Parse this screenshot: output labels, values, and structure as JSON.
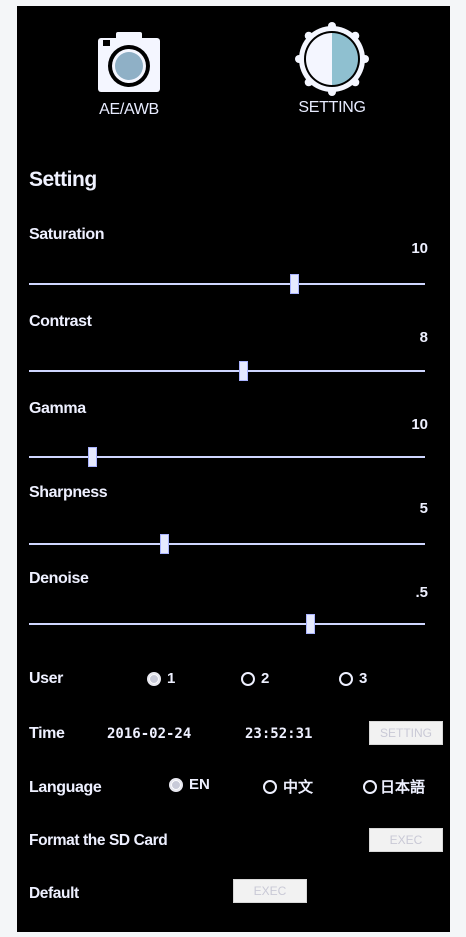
{
  "tabs": [
    {
      "label": "AE/AWB",
      "icon": "camera-icon"
    },
    {
      "label": "SETTING",
      "icon": "setting-icon"
    }
  ],
  "title": "Setting",
  "sliders": [
    {
      "label": "Saturation",
      "value": "10",
      "level": 0.67
    },
    {
      "label": "Contrast",
      "value": "8",
      "level": 0.54
    },
    {
      "label": "Gamma",
      "value": "10",
      "level": 0.16
    },
    {
      "label": "Sharpness",
      "value": "5",
      "level": 0.34
    },
    {
      "label": "Denoise",
      "value": ".5",
      "level": 0.71
    }
  ],
  "user": {
    "label": "User",
    "options": [
      "1",
      "2",
      "3"
    ],
    "selected": "1"
  },
  "time": {
    "label": "Time",
    "date": "2016-02-24",
    "clock": "23:52:31",
    "button": "SETTING"
  },
  "language": {
    "label": "Language",
    "options": [
      "EN",
      "中文",
      "日本語"
    ],
    "selected": "EN"
  },
  "format": {
    "label": "Format the SD Card",
    "button": "EXEC"
  },
  "default": {
    "label": "Default",
    "button": "EXEC"
  },
  "colors": {
    "background": "#000000",
    "text": "#eef0ff",
    "track": "#cfd6ff",
    "button_bg": "#f2f2f2"
  }
}
